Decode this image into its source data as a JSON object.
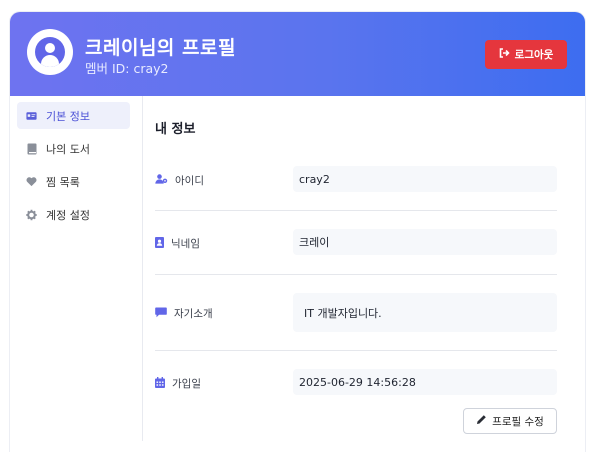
{
  "header": {
    "title": "크레이님의 프로필",
    "member_id": "멤버 ID: cray2",
    "logout_label": "로그아웃",
    "gradient_start": "#6e73f0",
    "gradient_end": "#3d6df0",
    "logout_color": "#e5363d"
  },
  "sidebar": {
    "items": [
      {
        "label": "기본 정보",
        "icon": "id-card-icon",
        "active": true
      },
      {
        "label": "나의 도서",
        "icon": "book-icon",
        "active": false
      },
      {
        "label": "찜 목록",
        "icon": "heart-icon",
        "active": false
      },
      {
        "label": "계정 설정",
        "icon": "gear-icon",
        "active": false
      }
    ]
  },
  "main": {
    "section_title": "내 정보",
    "fields": [
      {
        "label": "아이디",
        "value": "cray2",
        "icon": "user-cog-icon"
      },
      {
        "label": "닉네임",
        "value": "크레이",
        "icon": "contact-card-icon"
      },
      {
        "label": "자기소개",
        "value": "IT 개발자입니다.",
        "icon": "comment-icon"
      },
      {
        "label": "가입일",
        "value": "2025-06-29 14:56:28",
        "icon": "calendar-icon"
      }
    ],
    "edit_label": "프로필 수정"
  },
  "colors": {
    "accent": "#6166e8",
    "active_bg": "#eef0fb"
  }
}
